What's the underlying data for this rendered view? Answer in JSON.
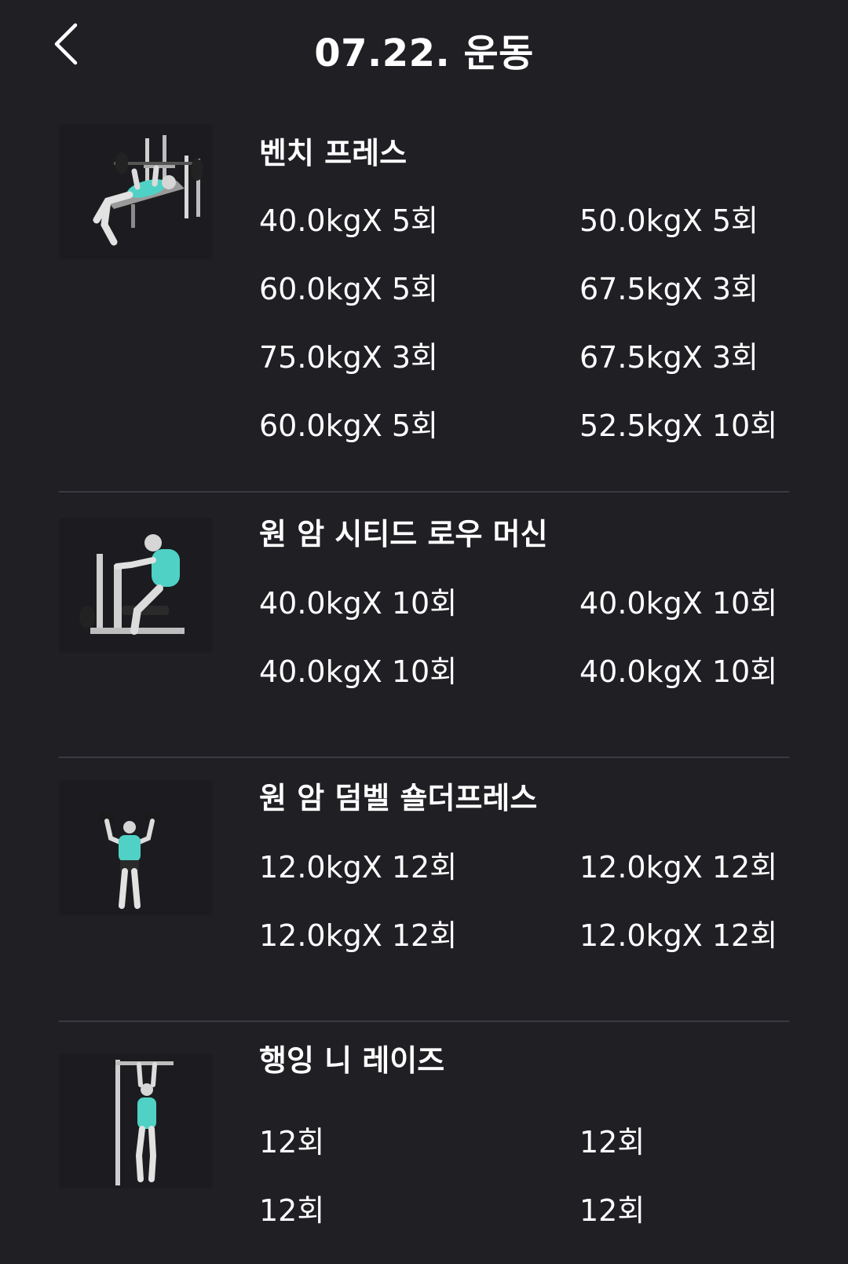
{
  "header": {
    "title": "07.22. 운동",
    "back_icon": "chevron-left-icon"
  },
  "colors": {
    "background": "#1f1f24",
    "text": "#ffffff",
    "divider": "#3a3a40",
    "muscle_accent": "#4fd1c5"
  },
  "exercises": [
    {
      "name": "벤치 프레스",
      "image": "bench-press-illustration",
      "sets": [
        "40.0kgX 5회",
        "50.0kgX 5회",
        "60.0kgX 5회",
        "67.5kgX 3회",
        "75.0kgX 3회",
        "67.5kgX 3회",
        "60.0kgX 5회",
        "52.5kgX 10회"
      ]
    },
    {
      "name": "원 암 시티드 로우 머신",
      "image": "seated-row-machine-illustration",
      "sets": [
        "40.0kgX 10회",
        "40.0kgX 10회",
        "40.0kgX 10회",
        "40.0kgX 10회"
      ]
    },
    {
      "name": "원 암 덤벨 숄더프레스",
      "image": "dumbbell-shoulder-press-illustration",
      "sets": [
        "12.0kgX 12회",
        "12.0kgX 12회",
        "12.0kgX 12회",
        "12.0kgX 12회"
      ]
    },
    {
      "name": "행잉 니 레이즈",
      "image": "hanging-knee-raise-illustration",
      "sets": [
        "12회",
        "12회",
        "12회",
        "12회"
      ]
    }
  ]
}
